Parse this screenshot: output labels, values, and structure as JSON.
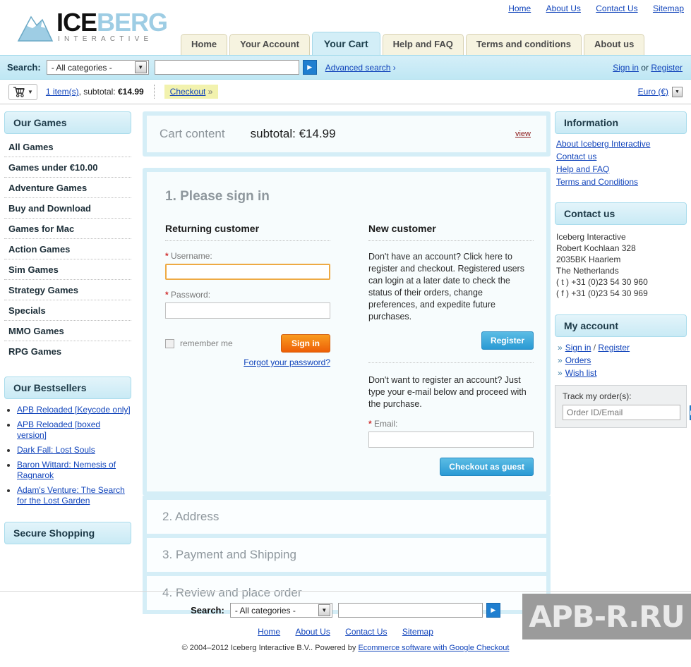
{
  "header": {
    "top_links": [
      "Home",
      "About Us",
      "Contact Us",
      "Sitemap"
    ],
    "logo": {
      "part1": "ICE",
      "part2": "BERG",
      "subtitle": "INTERACTIVE"
    },
    "tabs": [
      {
        "label": "Home",
        "active": false
      },
      {
        "label": "Your Account",
        "active": false
      },
      {
        "label": "Your Cart",
        "active": true
      },
      {
        "label": "Help and FAQ",
        "active": false
      },
      {
        "label": "Terms and conditions",
        "active": false
      },
      {
        "label": "About us",
        "active": false
      }
    ]
  },
  "search": {
    "label": "Search:",
    "category_selected": "- All categories -",
    "query_value": "",
    "go_icon": "play-arrow-icon",
    "advanced_label": "Advanced search",
    "advanced_chevron": "›",
    "sign_in": "Sign in",
    "or": "or",
    "register": "Register"
  },
  "cart_bar": {
    "cart_icon": "shopping-cart-icon",
    "caret": "▼",
    "items_link": "1 item(s)",
    "subtotal_text": ", subtotal: ",
    "subtotal_value": "€14.99",
    "checkout_label": "Checkout",
    "checkout_chevron": "»",
    "currency_label": "Euro (€)",
    "currency_caret": "▼"
  },
  "sidebar_left": {
    "our_games": {
      "title": "Our Games",
      "items": [
        "All Games",
        "Games under €10.00",
        "Adventure Games",
        "Buy and Download",
        "Games for Mac",
        "Action Games",
        "Sim Games",
        "Strategy Games",
        "Specials",
        "MMO Games",
        "RPG Games"
      ]
    },
    "bestsellers": {
      "title": "Our Bestsellers",
      "items": [
        "APB Reloaded [Keycode only]",
        "APB Reloaded [boxed version]",
        "Dark Fall: Lost Souls",
        "Baron Wittard: Nemesis of Ragnarok",
        "Adam's Venture: The Search for the Lost Garden"
      ]
    },
    "secure_shopping": {
      "title": "Secure Shopping"
    }
  },
  "main": {
    "cart_content": {
      "title": "Cart content",
      "subtotal_label": "subtotal: €14.99",
      "view_link": "view"
    },
    "step1": {
      "title": "1. Please sign in",
      "returning": {
        "heading": "Returning customer",
        "username_label": "Username:",
        "username_value": "",
        "password_label": "Password:",
        "password_value": "",
        "remember_label": "remember me",
        "signin_button": "Sign in",
        "forgot_link": "Forgot your password?"
      },
      "newcust": {
        "heading": "New customer",
        "blurb1": "Don't have an account? Click here to register and checkout. Registered users can login at a later date to check the status of their orders, change preferences, and expedite future purchases.",
        "register_button": "Register",
        "blurb2": "Don't want to register an account? Just type your e-mail below and proceed with the purchase.",
        "email_label": "Email:",
        "email_value": "",
        "guest_button": "Checkout as guest"
      }
    },
    "steps": [
      "2. Address",
      "3. Payment and Shipping",
      "4. Review and place order"
    ]
  },
  "sidebar_right": {
    "information": {
      "title": "Information",
      "links": [
        "About Iceberg Interactive",
        "Contact us",
        "Help and FAQ",
        "Terms and Conditions"
      ]
    },
    "contact": {
      "title": "Contact us",
      "lines": [
        "Iceberg Interactive",
        "Robert Kochlaan 328",
        "2035BK Haarlem",
        "The Netherlands",
        "( t ) +31 (0)23 54 30 960",
        "( f ) +31 (0)23 54 30 969"
      ]
    },
    "my_account": {
      "title": "My account",
      "sign_in": "Sign in",
      "separator": "/",
      "register": "Register",
      "orders": "Orders",
      "wish_list": "Wish list",
      "bullet": "»",
      "track_label": "Track my order(s):",
      "track_placeholder": "Order ID/Email",
      "track_value": "",
      "track_go_icon": "play-arrow-icon"
    }
  },
  "footer": {
    "search_label": "Search:",
    "category_selected": "- All categories -",
    "query_value": "",
    "links": [
      "Home",
      "About Us",
      "Contact Us",
      "Sitemap"
    ],
    "copyright_prefix": "© 2004–2012 Iceberg Interactive B.V.. Powered by ",
    "powered_link": "Ecommerce software with Google Checkout",
    "watermark": "APB-R.RU"
  },
  "colors": {
    "accent_blue": "#1f7fd0",
    "panel_border": "#d5eef7",
    "tab_cream": "#f6f3e0",
    "link": "#1144bb",
    "orange_button": "#ed5f08",
    "required": "#d03030",
    "highlight_yellow": "#f2f2ae"
  }
}
